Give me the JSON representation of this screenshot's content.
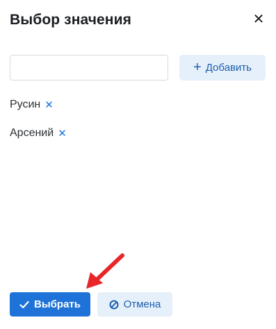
{
  "dialog": {
    "title": "Выбор значения",
    "close_icon": "close-icon"
  },
  "input": {
    "value": "",
    "placeholder": ""
  },
  "add_button": {
    "icon": "plus-icon",
    "label": "Добавить"
  },
  "tags": [
    {
      "label": "Русин",
      "remove_icon": "remove-icon"
    },
    {
      "label": "Арсений",
      "remove_icon": "remove-icon"
    }
  ],
  "footer": {
    "select_button": {
      "icon": "check-icon",
      "label": "Выбрать"
    },
    "cancel_button": {
      "icon": "cancel-icon",
      "label": "Отмена"
    }
  },
  "annotation": {
    "arrow_color": "#e8262a",
    "points_to": "select-button"
  },
  "colors": {
    "primary": "#1f73d8",
    "secondary_bg": "#e6f0fb",
    "secondary_text": "#1e5fae",
    "tag_remove": "#1a73d9"
  }
}
